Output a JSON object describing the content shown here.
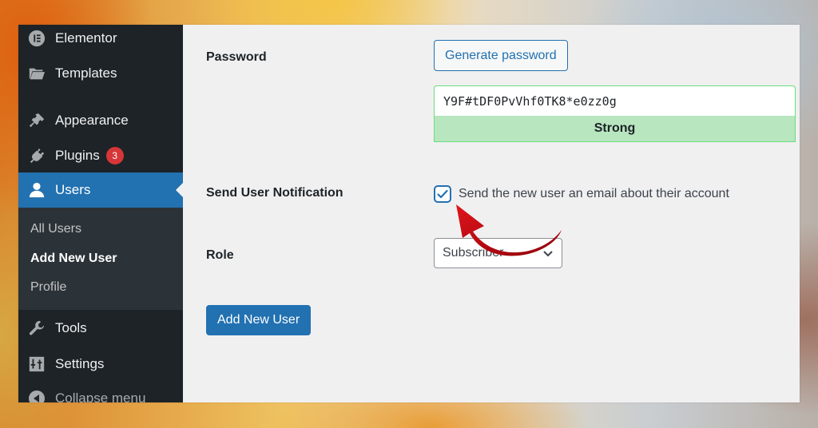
{
  "sidebar": {
    "items": [
      {
        "label": "Elementor",
        "icon": "elementor-icon"
      },
      {
        "label": "Templates",
        "icon": "folder-icon"
      },
      {
        "label": "Appearance",
        "icon": "paintbrush-icon"
      },
      {
        "label": "Plugins",
        "icon": "plugin-icon",
        "badge": "3"
      },
      {
        "label": "Users",
        "icon": "user-icon",
        "active": true
      },
      {
        "label": "Tools",
        "icon": "wrench-icon"
      },
      {
        "label": "Settings",
        "icon": "settings-sliders-icon"
      },
      {
        "label": "Collapse menu",
        "icon": "collapse-icon"
      }
    ],
    "submenu": [
      {
        "label": "All Users"
      },
      {
        "label": "Add New User",
        "current": true
      },
      {
        "label": "Profile"
      }
    ]
  },
  "form": {
    "password": {
      "label": "Password",
      "generate_button": "Generate password",
      "value": "Y9F#tDF0PvVhf0TK8*e0zz0g",
      "strength": "Strong"
    },
    "notification": {
      "label": "Send User Notification",
      "checkbox_label": "Send the new user an email about their account",
      "checked": true
    },
    "role": {
      "label": "Role",
      "selected": "Subscriber"
    },
    "submit_label": "Add New User"
  },
  "colors": {
    "sidebar_bg": "#1d2327",
    "submenu_bg": "#2c3338",
    "accent": "#2271b1",
    "badge": "#d63638",
    "strength_bg": "#b8e6bf",
    "annotation_arrow": "#c0070f"
  }
}
